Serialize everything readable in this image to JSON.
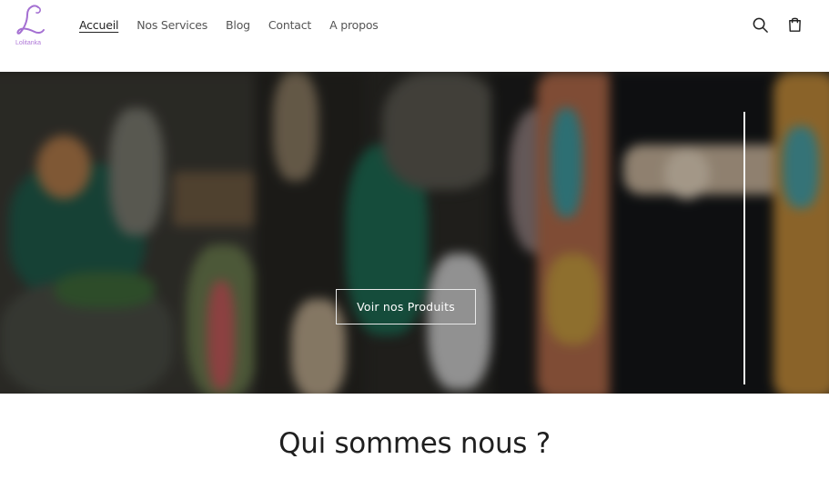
{
  "brand": {
    "logo_letter": "L",
    "logo_text": "Lolitanka",
    "accent": "#b07ad8"
  },
  "nav": {
    "items": [
      {
        "label": "Accueil",
        "active": true
      },
      {
        "label": "Nos Services",
        "active": false
      },
      {
        "label": "Blog",
        "active": false
      },
      {
        "label": "Contact",
        "active": false
      },
      {
        "label": "A propos",
        "active": false
      }
    ]
  },
  "header_icons": {
    "search": "search-icon",
    "cart": "cart-icon"
  },
  "hero": {
    "button_label": "Voir nos Produits"
  },
  "section": {
    "title": "Qui sommes nous ?"
  }
}
